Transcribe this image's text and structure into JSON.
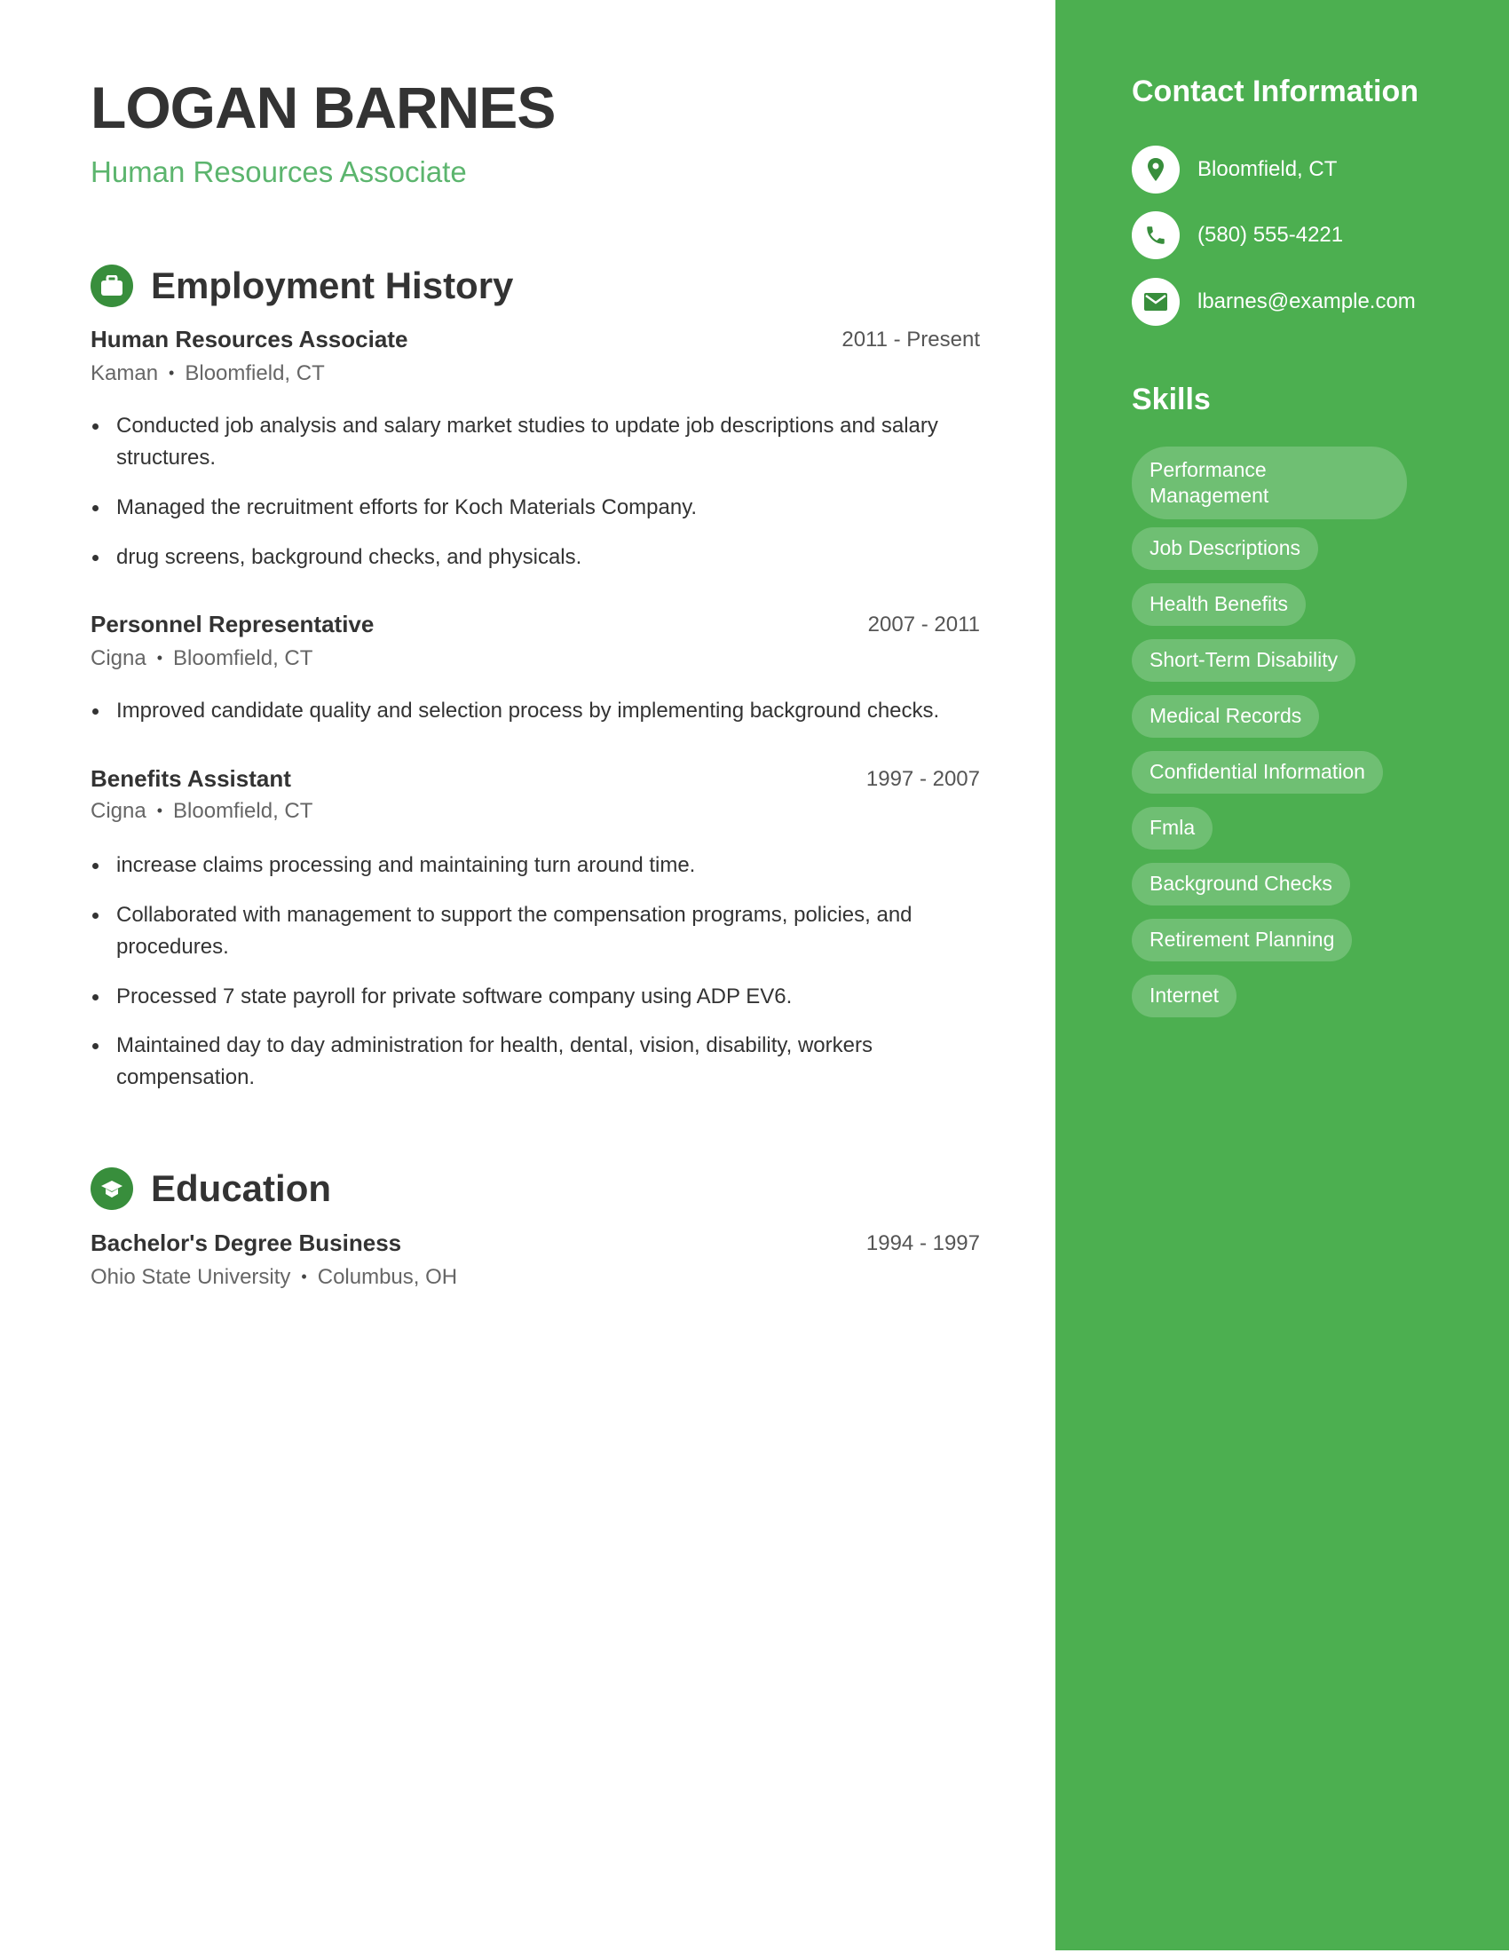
{
  "header": {
    "name": "LOGAN BARNES",
    "title": "Human Resources Associate"
  },
  "employment": {
    "heading": "Employment History",
    "icon": "briefcase-icon",
    "jobs": [
      {
        "title": "Human Resources Associate",
        "dates": "2011 - Present",
        "company": "Kaman",
        "location": "Bloomfield, CT",
        "bullets": [
          "Conducted job analysis and salary market studies to update job descriptions and salary structures.",
          "Managed the recruitment efforts for Koch Materials Company.",
          "drug screens, background checks, and physicals."
        ]
      },
      {
        "title": "Personnel Representative",
        "dates": "2007 - 2011",
        "company": "Cigna",
        "location": "Bloomfield, CT",
        "bullets": [
          "Improved candidate quality and selection process by implementing background checks."
        ]
      },
      {
        "title": "Benefits Assistant",
        "dates": "1997 - 2007",
        "company": "Cigna",
        "location": "Bloomfield, CT",
        "bullets": [
          "increase claims processing and maintaining turn around time.",
          "Collaborated with management to support the compensation programs, policies, and procedures.",
          "Processed 7 state payroll for private software company using ADP EV6.",
          "Maintained day to day administration for health, dental, vision, disability, workers compensation."
        ]
      }
    ]
  },
  "education": {
    "heading": "Education",
    "icon": "graduation-cap-icon",
    "items": [
      {
        "degree": "Bachelor's Degree Business",
        "dates": "1994 - 1997",
        "school": "Ohio State University",
        "location": "Columbus, OH"
      }
    ]
  },
  "sidebar": {
    "contact_heading": "Contact Information",
    "contact": [
      {
        "icon": "location-pin-icon",
        "value": "Bloomfield, CT"
      },
      {
        "icon": "phone-icon",
        "value": "(580) 555-4221"
      },
      {
        "icon": "email-icon",
        "value": "lbarnes@example.com"
      }
    ],
    "skills_heading": "Skills",
    "skills": [
      "Performance Management",
      "Job Descriptions",
      "Health Benefits",
      "Short-Term Disability",
      "Medical Records",
      "Confidential Information",
      "Fmla",
      "Background Checks",
      "Retirement Planning",
      "Internet"
    ]
  },
  "colors": {
    "sidebar": "#4caf50",
    "accent_dark": "#388e3c",
    "subtitle": "#5cb56e",
    "text": "#333333"
  }
}
